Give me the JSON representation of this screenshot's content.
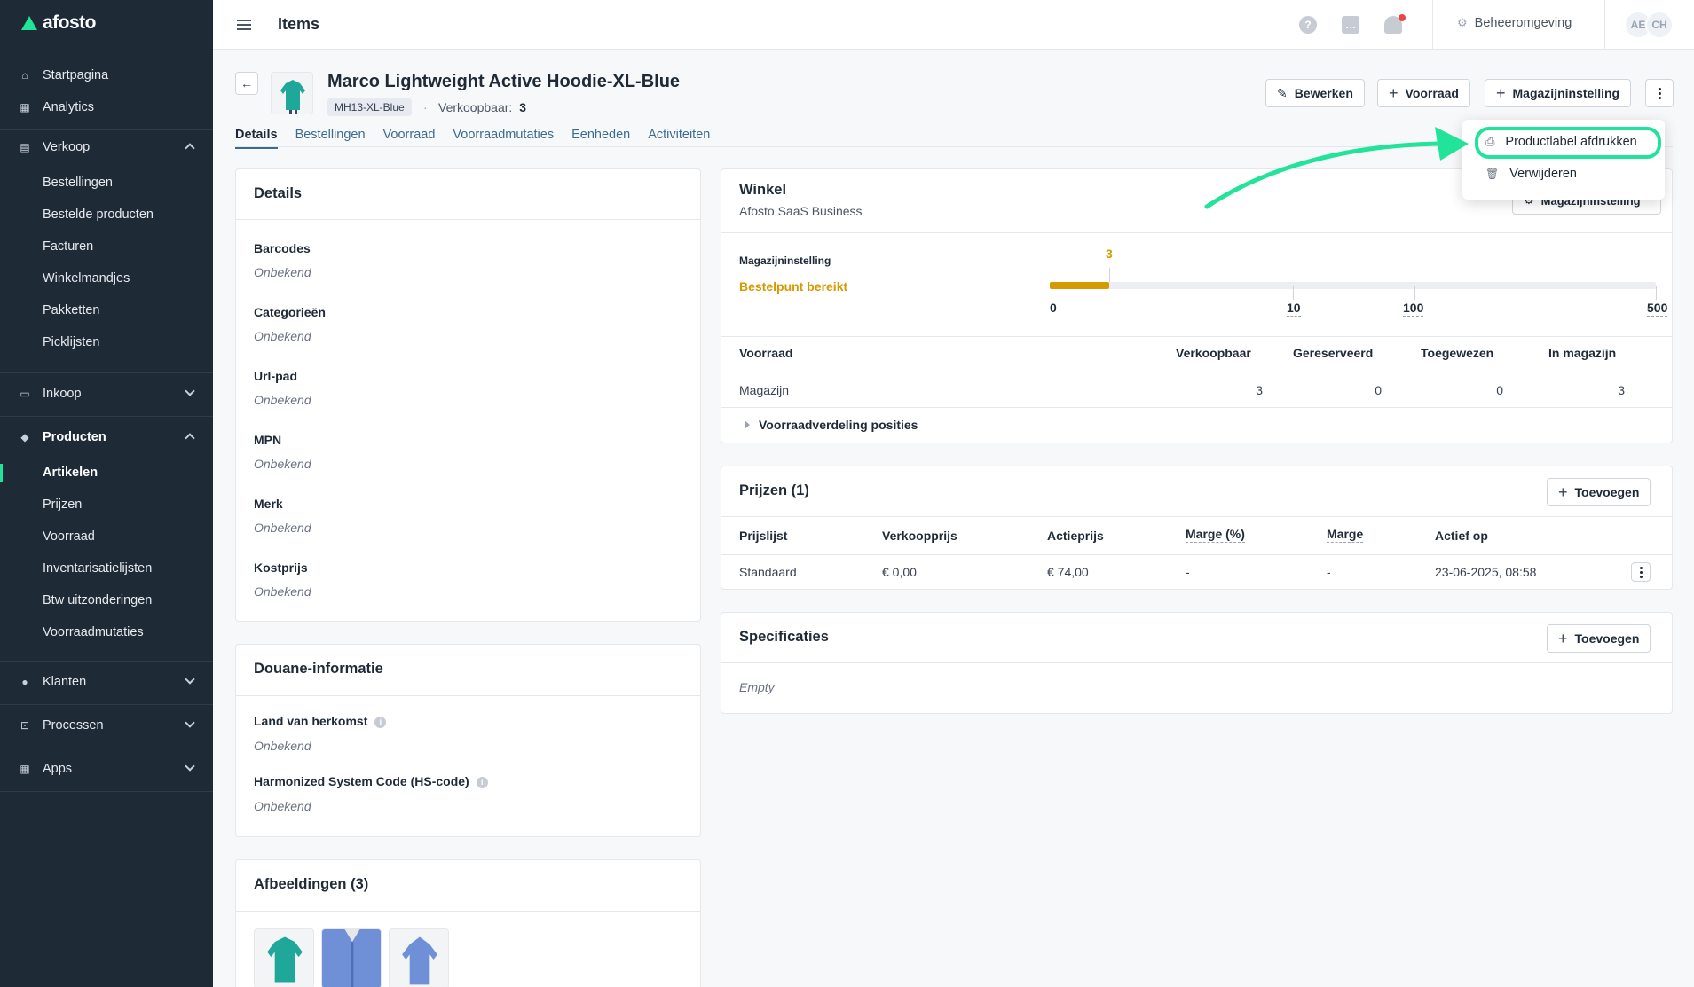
{
  "app": {
    "logo": "afosto"
  },
  "sidebar": {
    "top_items": [
      {
        "label": "Startpagina",
        "icon": "home-icon"
      },
      {
        "label": "Analytics",
        "icon": "grid-icon"
      }
    ],
    "verkoop": {
      "label": "Verkoop",
      "items": [
        "Bestellingen",
        "Bestelde producten",
        "Facturen",
        "Winkelmandjes",
        "Pakketten",
        "Picklijsten"
      ]
    },
    "inkoop": {
      "label": "Inkoop"
    },
    "producten": {
      "label": "Producten",
      "items": [
        "Artikelen",
        "Prijzen",
        "Voorraad",
        "Inventarisatielijsten",
        "Btw uitzonderingen",
        "Voorraadmutaties"
      ],
      "active": "Artikelen"
    },
    "klanten": {
      "label": "Klanten"
    },
    "processen": {
      "label": "Processen"
    },
    "apps": {
      "label": "Apps"
    }
  },
  "topbar": {
    "title": "Items",
    "environment": "Beheeromgeving",
    "avatars": [
      "AE",
      "CH"
    ]
  },
  "product": {
    "title": "Marco Lightweight Active Hoodie-XL-Blue",
    "sku": "MH13-XL-Blue",
    "verkoopbaar_label": "Verkoopbaar:",
    "verkoopbaar_value": "3"
  },
  "actions": {
    "edit": "Bewerken",
    "stock": "Voorraad",
    "warehouse": "Magazijninstelling"
  },
  "dropdown": {
    "print": "Productlabel afdrukken",
    "delete": "Verwijderen"
  },
  "tabs": [
    "Details",
    "Bestellingen",
    "Voorraad",
    "Voorraadmutaties",
    "Eenheden",
    "Activiteiten"
  ],
  "details": {
    "title": "Details",
    "fields": [
      {
        "label": "Barcodes",
        "value": "Onbekend"
      },
      {
        "label": "Categorieën",
        "value": "Onbekend"
      },
      {
        "label": "Url-pad",
        "value": "Onbekend"
      },
      {
        "label": "MPN",
        "value": "Onbekend"
      },
      {
        "label": "Merk",
        "value": "Onbekend"
      },
      {
        "label": "Kostprijs",
        "value": "Onbekend"
      }
    ]
  },
  "customs": {
    "title": "Douane-informatie",
    "fields": [
      {
        "label": "Land van herkomst",
        "value": "Onbekend"
      },
      {
        "label": "Harmonized System Code (HS-code)",
        "value": "Onbekend"
      }
    ]
  },
  "images": {
    "title": "Afbeeldingen (3)"
  },
  "winkel": {
    "title": "Winkel",
    "subtitle": "Afosto SaaS Business",
    "hidden_button": "Magazijninstelling",
    "stock_label": "Magazijninstelling",
    "status": "Bestelpunt bereikt",
    "current": "3",
    "current_fraction": 0.098,
    "ticks": [
      "0",
      "10",
      "100",
      "500"
    ],
    "table": {
      "headers": [
        "Voorraad",
        "Verkoopbaar",
        "Gereserveerd",
        "Toegewezen",
        "In magazijn"
      ],
      "rows": [
        [
          "Magazijn",
          "3",
          "0",
          "0",
          "3"
        ]
      ]
    },
    "expand": "Voorraadverdeling posities"
  },
  "prices": {
    "title": "Prijzen (1)",
    "add": "Toevoegen",
    "headers": [
      "Prijslijst",
      "Verkoopprijs",
      "Actieprijs",
      "Marge (%)",
      "Marge",
      "Actief op"
    ],
    "rows": [
      [
        "Standaard",
        "€ 0,00",
        "€ 74,00",
        "-",
        "-",
        "23-06-2025, 08:58"
      ]
    ]
  },
  "specs": {
    "title": "Specificaties",
    "add": "Toevoegen",
    "empty": "Empty"
  },
  "colors": {
    "accent": "#22e39a",
    "warning": "#d49a00",
    "sidebar": "#1f2a37",
    "link": "#3d6b8f"
  }
}
